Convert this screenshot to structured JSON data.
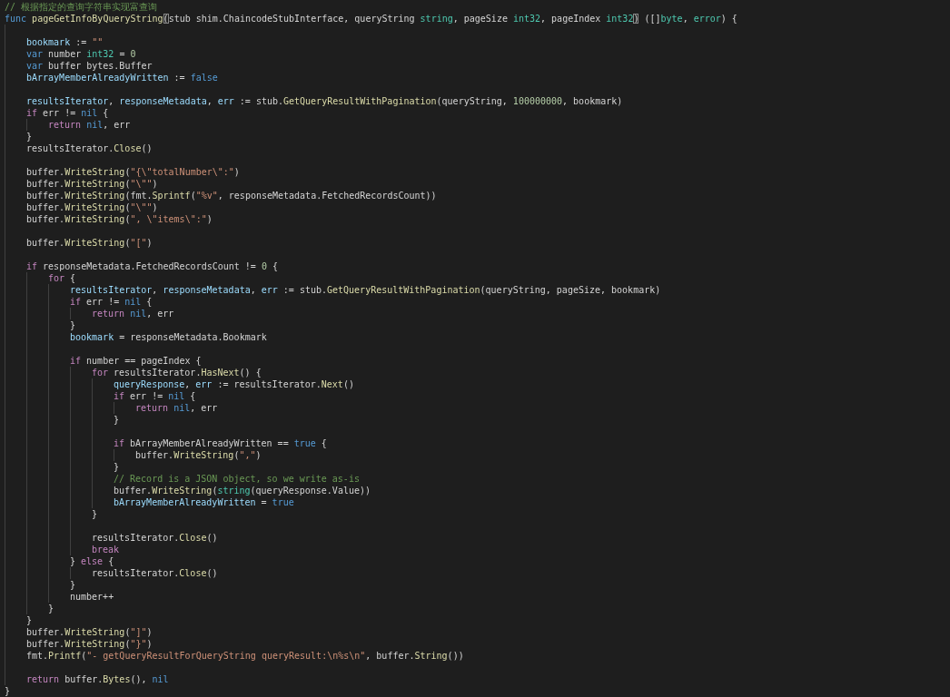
{
  "editor": {
    "lines": [
      {
        "kind": "code",
        "tokens": [
          {
            "kind": "comment",
            "text": "// 根据指定的查询字符串实现富查询"
          }
        ]
      },
      {
        "kind": "code",
        "tokens": [
          {
            "kind": "keyword",
            "text": "func "
          },
          {
            "kind": "function",
            "text": "pageGetInfoByQueryString"
          },
          {
            "kind": "bracket",
            "text": "("
          },
          {
            "kind": "plain",
            "text": "stub shim.ChaincodeStubInterface, queryString "
          },
          {
            "kind": "type",
            "text": "string"
          },
          {
            "kind": "plain",
            "text": ", pageSize "
          },
          {
            "kind": "type",
            "text": "int32"
          },
          {
            "kind": "plain",
            "text": ", pageIndex "
          },
          {
            "kind": "type",
            "text": "int32"
          },
          {
            "kind": "bracket",
            "text": ")"
          },
          {
            "kind": "plain",
            "text": " ([]"
          },
          {
            "kind": "type",
            "text": "byte"
          },
          {
            "kind": "plain",
            "text": ", "
          },
          {
            "kind": "type",
            "text": "error"
          },
          {
            "kind": "plain",
            "text": ") {"
          }
        ],
        "children": [
          {
            "kind": "blank"
          },
          {
            "kind": "code",
            "tokens": [
              {
                "kind": "variable",
                "text": "bookmark"
              },
              {
                "kind": "plain",
                "text": " := "
              },
              {
                "kind": "string",
                "text": "\"\""
              }
            ]
          },
          {
            "kind": "code",
            "tokens": [
              {
                "kind": "keyword",
                "text": "var "
              },
              {
                "kind": "plain",
                "text": "number "
              },
              {
                "kind": "type",
                "text": "int32"
              },
              {
                "kind": "plain",
                "text": " = "
              },
              {
                "kind": "number",
                "text": "0"
              }
            ]
          },
          {
            "kind": "code",
            "tokens": [
              {
                "kind": "keyword",
                "text": "var "
              },
              {
                "kind": "plain",
                "text": "buffer bytes.Buffer"
              }
            ]
          },
          {
            "kind": "code",
            "tokens": [
              {
                "kind": "variable",
                "text": "bArrayMemberAlreadyWritten"
              },
              {
                "kind": "plain",
                "text": " := "
              },
              {
                "kind": "constant",
                "text": "false"
              }
            ]
          },
          {
            "kind": "blank"
          },
          {
            "kind": "code",
            "tokens": [
              {
                "kind": "variable",
                "text": "resultsIterator"
              },
              {
                "kind": "plain",
                "text": ", "
              },
              {
                "kind": "variable",
                "text": "responseMetadata"
              },
              {
                "kind": "plain",
                "text": ", "
              },
              {
                "kind": "variable",
                "text": "err"
              },
              {
                "kind": "plain",
                "text": " := stub."
              },
              {
                "kind": "function",
                "text": "GetQueryResultWithPagination"
              },
              {
                "kind": "plain",
                "text": "(queryString, "
              },
              {
                "kind": "number",
                "text": "100000000"
              },
              {
                "kind": "plain",
                "text": ", bookmark)"
              }
            ]
          },
          {
            "kind": "code",
            "tokens": [
              {
                "kind": "control",
                "text": "if"
              },
              {
                "kind": "plain",
                "text": " err != "
              },
              {
                "kind": "constant",
                "text": "nil"
              },
              {
                "kind": "plain",
                "text": " {"
              }
            ],
            "children": [
              {
                "kind": "code",
                "tokens": [
                  {
                    "kind": "control",
                    "text": "return "
                  },
                  {
                    "kind": "constant",
                    "text": "nil"
                  },
                  {
                    "kind": "plain",
                    "text": ", err"
                  }
                ]
              }
            ]
          },
          {
            "kind": "code",
            "tokens": [
              {
                "kind": "plain",
                "text": "}"
              }
            ]
          },
          {
            "kind": "code",
            "tokens": [
              {
                "kind": "plain",
                "text": "resultsIterator."
              },
              {
                "kind": "function",
                "text": "Close"
              },
              {
                "kind": "plain",
                "text": "()"
              }
            ]
          },
          {
            "kind": "blank"
          },
          {
            "kind": "code",
            "tokens": [
              {
                "kind": "plain",
                "text": "buffer."
              },
              {
                "kind": "function",
                "text": "WriteString"
              },
              {
                "kind": "plain",
                "text": "("
              },
              {
                "kind": "string",
                "text": "\"{\\\"totalNumber\\\":\""
              },
              {
                "kind": "plain",
                "text": ")"
              }
            ]
          },
          {
            "kind": "code",
            "tokens": [
              {
                "kind": "plain",
                "text": "buffer."
              },
              {
                "kind": "function",
                "text": "WriteString"
              },
              {
                "kind": "plain",
                "text": "("
              },
              {
                "kind": "string",
                "text": "\"\\\"\""
              },
              {
                "kind": "plain",
                "text": ")"
              }
            ]
          },
          {
            "kind": "code",
            "tokens": [
              {
                "kind": "plain",
                "text": "buffer."
              },
              {
                "kind": "function",
                "text": "WriteString"
              },
              {
                "kind": "plain",
                "text": "(fmt."
              },
              {
                "kind": "function",
                "text": "Sprintf"
              },
              {
                "kind": "plain",
                "text": "("
              },
              {
                "kind": "string",
                "text": "\"%v\""
              },
              {
                "kind": "plain",
                "text": ", responseMetadata.FetchedRecordsCount))"
              }
            ]
          },
          {
            "kind": "code",
            "tokens": [
              {
                "kind": "plain",
                "text": "buffer."
              },
              {
                "kind": "function",
                "text": "WriteString"
              },
              {
                "kind": "plain",
                "text": "("
              },
              {
                "kind": "string",
                "text": "\"\\\"\""
              },
              {
                "kind": "plain",
                "text": ")"
              }
            ]
          },
          {
            "kind": "code",
            "tokens": [
              {
                "kind": "plain",
                "text": "buffer."
              },
              {
                "kind": "function",
                "text": "WriteString"
              },
              {
                "kind": "plain",
                "text": "("
              },
              {
                "kind": "string",
                "text": "\", \\\"items\\\":\""
              },
              {
                "kind": "plain",
                "text": ")"
              }
            ]
          },
          {
            "kind": "blank"
          },
          {
            "kind": "code",
            "tokens": [
              {
                "kind": "plain",
                "text": "buffer."
              },
              {
                "kind": "function",
                "text": "WriteString"
              },
              {
                "kind": "plain",
                "text": "("
              },
              {
                "kind": "string",
                "text": "\"[\""
              },
              {
                "kind": "plain",
                "text": ")"
              }
            ]
          },
          {
            "kind": "blank"
          },
          {
            "kind": "code",
            "tokens": [
              {
                "kind": "control",
                "text": "if"
              },
              {
                "kind": "plain",
                "text": " responseMetadata.FetchedRecordsCount != "
              },
              {
                "kind": "number",
                "text": "0"
              },
              {
                "kind": "plain",
                "text": " {"
              }
            ],
            "children": [
              {
                "kind": "code",
                "tokens": [
                  {
                    "kind": "control",
                    "text": "for"
                  },
                  {
                    "kind": "plain",
                    "text": " {"
                  }
                ],
                "children": [
                  {
                    "kind": "code",
                    "tokens": [
                      {
                        "kind": "variable",
                        "text": "resultsIterator"
                      },
                      {
                        "kind": "plain",
                        "text": ", "
                      },
                      {
                        "kind": "variable",
                        "text": "responseMetadata"
                      },
                      {
                        "kind": "plain",
                        "text": ", "
                      },
                      {
                        "kind": "variable",
                        "text": "err"
                      },
                      {
                        "kind": "plain",
                        "text": " := stub."
                      },
                      {
                        "kind": "function",
                        "text": "GetQueryResultWithPagination"
                      },
                      {
                        "kind": "plain",
                        "text": "(queryString, pageSize, bookmark)"
                      }
                    ]
                  },
                  {
                    "kind": "code",
                    "tokens": [
                      {
                        "kind": "control",
                        "text": "if"
                      },
                      {
                        "kind": "plain",
                        "text": " err != "
                      },
                      {
                        "kind": "constant",
                        "text": "nil"
                      },
                      {
                        "kind": "plain",
                        "text": " {"
                      }
                    ],
                    "children": [
                      {
                        "kind": "code",
                        "tokens": [
                          {
                            "kind": "control",
                            "text": "return "
                          },
                          {
                            "kind": "constant",
                            "text": "nil"
                          },
                          {
                            "kind": "plain",
                            "text": ", err"
                          }
                        ]
                      }
                    ]
                  },
                  {
                    "kind": "code",
                    "tokens": [
                      {
                        "kind": "plain",
                        "text": "}"
                      }
                    ]
                  },
                  {
                    "kind": "code",
                    "tokens": [
                      {
                        "kind": "variable",
                        "text": "bookmark"
                      },
                      {
                        "kind": "plain",
                        "text": " = responseMetadata.Bookmark"
                      }
                    ]
                  },
                  {
                    "kind": "blank"
                  },
                  {
                    "kind": "code",
                    "tokens": [
                      {
                        "kind": "control",
                        "text": "if"
                      },
                      {
                        "kind": "plain",
                        "text": " number == pageIndex {"
                      }
                    ],
                    "children": [
                      {
                        "kind": "code",
                        "tokens": [
                          {
                            "kind": "control",
                            "text": "for"
                          },
                          {
                            "kind": "plain",
                            "text": " resultsIterator."
                          },
                          {
                            "kind": "function",
                            "text": "HasNext"
                          },
                          {
                            "kind": "plain",
                            "text": "() {"
                          }
                        ],
                        "children": [
                          {
                            "kind": "code",
                            "tokens": [
                              {
                                "kind": "variable",
                                "text": "queryResponse"
                              },
                              {
                                "kind": "plain",
                                "text": ", "
                              },
                              {
                                "kind": "variable",
                                "text": "err"
                              },
                              {
                                "kind": "plain",
                                "text": " := resultsIterator."
                              },
                              {
                                "kind": "function",
                                "text": "Next"
                              },
                              {
                                "kind": "plain",
                                "text": "()"
                              }
                            ]
                          },
                          {
                            "kind": "code",
                            "tokens": [
                              {
                                "kind": "control",
                                "text": "if"
                              },
                              {
                                "kind": "plain",
                                "text": " err != "
                              },
                              {
                                "kind": "constant",
                                "text": "nil"
                              },
                              {
                                "kind": "plain",
                                "text": " {"
                              }
                            ],
                            "children": [
                              {
                                "kind": "code",
                                "tokens": [
                                  {
                                    "kind": "control",
                                    "text": "return "
                                  },
                                  {
                                    "kind": "constant",
                                    "text": "nil"
                                  },
                                  {
                                    "kind": "plain",
                                    "text": ", err"
                                  }
                                ]
                              }
                            ]
                          },
                          {
                            "kind": "code",
                            "tokens": [
                              {
                                "kind": "plain",
                                "text": "}"
                              }
                            ]
                          },
                          {
                            "kind": "blank"
                          },
                          {
                            "kind": "code",
                            "tokens": [
                              {
                                "kind": "control",
                                "text": "if"
                              },
                              {
                                "kind": "plain",
                                "text": " bArrayMemberAlreadyWritten == "
                              },
                              {
                                "kind": "constant",
                                "text": "true"
                              },
                              {
                                "kind": "plain",
                                "text": " {"
                              }
                            ],
                            "children": [
                              {
                                "kind": "code",
                                "tokens": [
                                  {
                                    "kind": "plain",
                                    "text": "buffer."
                                  },
                                  {
                                    "kind": "function",
                                    "text": "WriteString"
                                  },
                                  {
                                    "kind": "plain",
                                    "text": "("
                                  },
                                  {
                                    "kind": "string",
                                    "text": "\",\""
                                  },
                                  {
                                    "kind": "plain",
                                    "text": ")"
                                  }
                                ]
                              }
                            ]
                          },
                          {
                            "kind": "code",
                            "tokens": [
                              {
                                "kind": "plain",
                                "text": "}"
                              }
                            ]
                          },
                          {
                            "kind": "code",
                            "tokens": [
                              {
                                "kind": "comment",
                                "text": "// Record is a JSON object, so we write as-is"
                              }
                            ]
                          },
                          {
                            "kind": "code",
                            "tokens": [
                              {
                                "kind": "plain",
                                "text": "buffer."
                              },
                              {
                                "kind": "function",
                                "text": "WriteString"
                              },
                              {
                                "kind": "plain",
                                "text": "("
                              },
                              {
                                "kind": "type",
                                "text": "string"
                              },
                              {
                                "kind": "plain",
                                "text": "(queryResponse.Value))"
                              }
                            ]
                          },
                          {
                            "kind": "code",
                            "tokens": [
                              {
                                "kind": "variable",
                                "text": "bArrayMemberAlreadyWritten"
                              },
                              {
                                "kind": "plain",
                                "text": " = "
                              },
                              {
                                "kind": "constant",
                                "text": "true"
                              }
                            ]
                          }
                        ]
                      },
                      {
                        "kind": "code",
                        "tokens": [
                          {
                            "kind": "plain",
                            "text": "}"
                          }
                        ]
                      },
                      {
                        "kind": "blank"
                      },
                      {
                        "kind": "code",
                        "tokens": [
                          {
                            "kind": "plain",
                            "text": "resultsIterator."
                          },
                          {
                            "kind": "function",
                            "text": "Close"
                          },
                          {
                            "kind": "plain",
                            "text": "()"
                          }
                        ]
                      },
                      {
                        "kind": "code",
                        "tokens": [
                          {
                            "kind": "control",
                            "text": "break"
                          }
                        ]
                      }
                    ]
                  },
                  {
                    "kind": "code",
                    "tokens": [
                      {
                        "kind": "plain",
                        "text": "} "
                      },
                      {
                        "kind": "control",
                        "text": "else"
                      },
                      {
                        "kind": "plain",
                        "text": " {"
                      }
                    ],
                    "children": [
                      {
                        "kind": "code",
                        "tokens": [
                          {
                            "kind": "plain",
                            "text": "resultsIterator."
                          },
                          {
                            "kind": "function",
                            "text": "Close"
                          },
                          {
                            "kind": "plain",
                            "text": "()"
                          }
                        ]
                      }
                    ]
                  },
                  {
                    "kind": "code",
                    "tokens": [
                      {
                        "kind": "plain",
                        "text": "}"
                      }
                    ]
                  },
                  {
                    "kind": "code",
                    "tokens": [
                      {
                        "kind": "plain",
                        "text": "number++"
                      }
                    ]
                  }
                ]
              },
              {
                "kind": "code",
                "tokens": [
                  {
                    "kind": "plain",
                    "text": "}"
                  }
                ]
              }
            ]
          },
          {
            "kind": "code",
            "tokens": [
              {
                "kind": "plain",
                "text": "}"
              }
            ]
          },
          {
            "kind": "code",
            "tokens": [
              {
                "kind": "plain",
                "text": "buffer."
              },
              {
                "kind": "function",
                "text": "WriteString"
              },
              {
                "kind": "plain",
                "text": "("
              },
              {
                "kind": "string",
                "text": "\"]\""
              },
              {
                "kind": "plain",
                "text": ")"
              }
            ]
          },
          {
            "kind": "code",
            "tokens": [
              {
                "kind": "plain",
                "text": "buffer."
              },
              {
                "kind": "function",
                "text": "WriteString"
              },
              {
                "kind": "plain",
                "text": "("
              },
              {
                "kind": "string",
                "text": "\"}\""
              },
              {
                "kind": "plain",
                "text": ")"
              }
            ]
          },
          {
            "kind": "code",
            "tokens": [
              {
                "kind": "plain",
                "text": "fmt."
              },
              {
                "kind": "function",
                "text": "Printf"
              },
              {
                "kind": "plain",
                "text": "("
              },
              {
                "kind": "string",
                "text": "\"- getQueryResultForQueryString queryResult:\\n%s\\n\""
              },
              {
                "kind": "plain",
                "text": ", buffer."
              },
              {
                "kind": "function",
                "text": "String"
              },
              {
                "kind": "plain",
                "text": "())"
              }
            ]
          },
          {
            "kind": "blank"
          },
          {
            "kind": "code",
            "tokens": [
              {
                "kind": "control",
                "text": "return"
              },
              {
                "kind": "plain",
                "text": " buffer."
              },
              {
                "kind": "function",
                "text": "Bytes"
              },
              {
                "kind": "plain",
                "text": "(), "
              },
              {
                "kind": "constant",
                "text": "nil"
              }
            ]
          }
        ]
      },
      {
        "kind": "code",
        "tokens": [
          {
            "kind": "plain",
            "text": "}"
          }
        ]
      }
    ]
  }
}
